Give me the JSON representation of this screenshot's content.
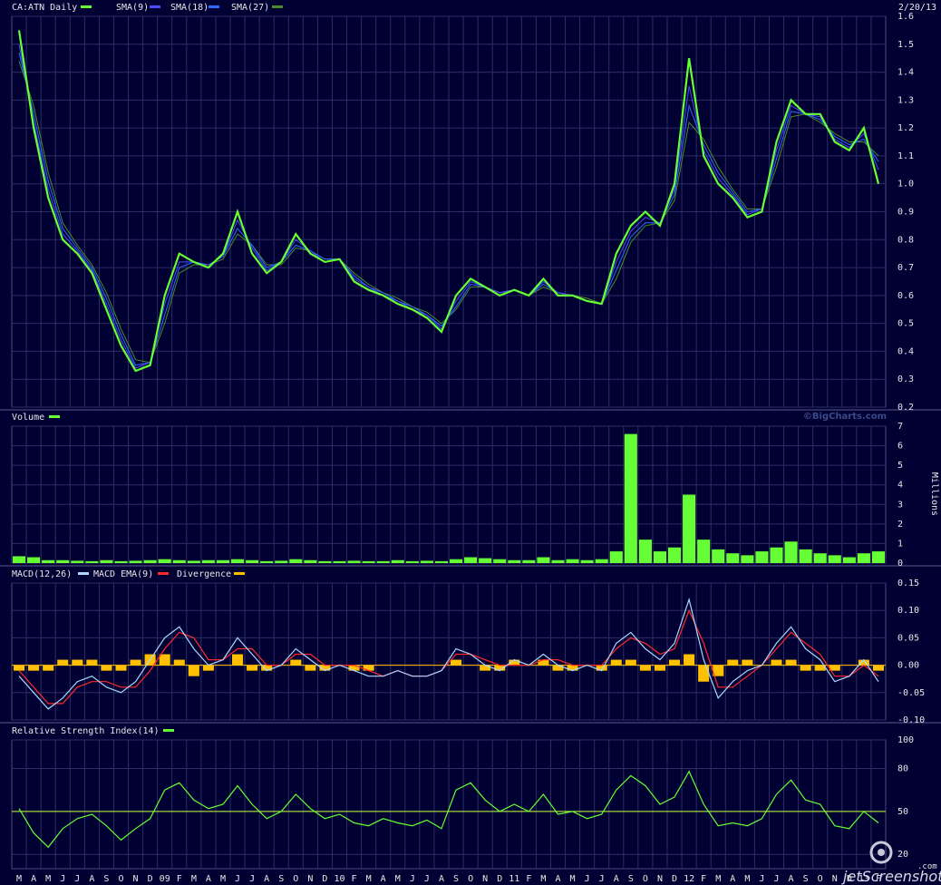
{
  "chart_data": [
    {
      "type": "line",
      "panel": "price",
      "title": "CA:ATN Daily",
      "date_label": "2/20/13",
      "ylim": [
        0.2,
        1.6
      ],
      "yticks": [
        "1.6",
        "1.5",
        "1.4",
        "1.3",
        "1.2",
        "1.1",
        "1.0",
        "0.9",
        "0.8",
        "0.7",
        "0.6",
        "0.5",
        "0.4",
        "0.3",
        "0.2"
      ],
      "legend": [
        {
          "name": "CA:ATN Daily",
          "color": "#66ff33"
        },
        {
          "name": "SMA(9)",
          "color": "#4a4aff"
        },
        {
          "name": "SMA(18)",
          "color": "#2b6bff"
        },
        {
          "name": "SMA(27)",
          "color": "#4d8a2a"
        }
      ],
      "x_months": [
        "M",
        "A",
        "M",
        "J",
        "J",
        "A",
        "S",
        "O",
        "N",
        "D",
        "09",
        "F",
        "M",
        "A",
        "M",
        "J",
        "J",
        "A",
        "S",
        "O",
        "N",
        "D",
        "10",
        "F",
        "M",
        "A",
        "M",
        "J",
        "J",
        "A",
        "S",
        "O",
        "N",
        "D",
        "11",
        "F",
        "M",
        "A",
        "M",
        "J",
        "J",
        "A",
        "S",
        "O",
        "N",
        "D",
        "12",
        "F",
        "M",
        "A",
        "M",
        "J",
        "J",
        "A",
        "S",
        "O",
        "N",
        "D",
        "13",
        "F"
      ],
      "series": [
        {
          "name": "CA:ATN Daily",
          "values": [
            1.55,
            1.2,
            0.95,
            0.8,
            0.75,
            0.68,
            0.55,
            0.42,
            0.33,
            0.35,
            0.6,
            0.75,
            0.72,
            0.7,
            0.75,
            0.9,
            0.75,
            0.68,
            0.72,
            0.82,
            0.75,
            0.72,
            0.73,
            0.65,
            0.62,
            0.6,
            0.57,
            0.55,
            0.52,
            0.47,
            0.6,
            0.66,
            0.63,
            0.6,
            0.62,
            0.6,
            0.66,
            0.6,
            0.6,
            0.58,
            0.57,
            0.75,
            0.85,
            0.9,
            0.85,
            1.0,
            1.45,
            1.1,
            1.0,
            0.95,
            0.88,
            0.9,
            1.15,
            1.3,
            1.25,
            1.25,
            1.15,
            1.12,
            1.2,
            1.0
          ]
        },
        {
          "name": "SMA(9)",
          "values": [
            1.5,
            1.22,
            0.98,
            0.82,
            0.76,
            0.69,
            0.57,
            0.44,
            0.34,
            0.36,
            0.57,
            0.72,
            0.72,
            0.71,
            0.74,
            0.87,
            0.77,
            0.69,
            0.72,
            0.8,
            0.76,
            0.72,
            0.73,
            0.66,
            0.63,
            0.6,
            0.58,
            0.55,
            0.53,
            0.48,
            0.58,
            0.65,
            0.63,
            0.61,
            0.62,
            0.6,
            0.65,
            0.61,
            0.6,
            0.58,
            0.57,
            0.72,
            0.83,
            0.88,
            0.86,
            0.98,
            1.35,
            1.12,
            1.02,
            0.96,
            0.89,
            0.91,
            1.12,
            1.28,
            1.25,
            1.24,
            1.16,
            1.13,
            1.18,
            1.05
          ]
        },
        {
          "name": "SMA(18)",
          "values": [
            1.47,
            1.25,
            1.01,
            0.84,
            0.77,
            0.7,
            0.59,
            0.46,
            0.35,
            0.36,
            0.53,
            0.7,
            0.72,
            0.71,
            0.74,
            0.84,
            0.78,
            0.7,
            0.72,
            0.78,
            0.76,
            0.73,
            0.73,
            0.67,
            0.63,
            0.61,
            0.58,
            0.56,
            0.53,
            0.49,
            0.56,
            0.64,
            0.63,
            0.61,
            0.62,
            0.6,
            0.64,
            0.61,
            0.6,
            0.58,
            0.57,
            0.69,
            0.81,
            0.86,
            0.86,
            0.96,
            1.28,
            1.14,
            1.04,
            0.97,
            0.9,
            0.91,
            1.09,
            1.26,
            1.25,
            1.23,
            1.17,
            1.14,
            1.16,
            1.08
          ]
        },
        {
          "name": "SMA(27)",
          "values": [
            1.44,
            1.28,
            1.04,
            0.86,
            0.78,
            0.71,
            0.61,
            0.48,
            0.37,
            0.36,
            0.5,
            0.68,
            0.71,
            0.71,
            0.73,
            0.82,
            0.78,
            0.71,
            0.71,
            0.77,
            0.76,
            0.73,
            0.73,
            0.68,
            0.64,
            0.61,
            0.59,
            0.56,
            0.54,
            0.5,
            0.55,
            0.63,
            0.63,
            0.61,
            0.62,
            0.6,
            0.63,
            0.61,
            0.6,
            0.59,
            0.57,
            0.66,
            0.79,
            0.85,
            0.86,
            0.94,
            1.22,
            1.16,
            1.06,
            0.98,
            0.91,
            0.91,
            1.06,
            1.24,
            1.25,
            1.22,
            1.18,
            1.15,
            1.15,
            1.1
          ]
        }
      ]
    },
    {
      "type": "bar",
      "panel": "volume",
      "title": "Volume",
      "watermark": "©BigCharts.com",
      "ylabel": "Millions",
      "ylim": [
        0,
        7
      ],
      "yticks": [
        "7",
        "6",
        "5",
        "4",
        "3",
        "2",
        "1",
        "0"
      ],
      "legend": [
        {
          "name": "Volume",
          "color": "#66ff33"
        }
      ],
      "values": [
        0.35,
        0.3,
        0.15,
        0.15,
        0.12,
        0.1,
        0.15,
        0.1,
        0.12,
        0.15,
        0.2,
        0.15,
        0.12,
        0.15,
        0.15,
        0.2,
        0.15,
        0.1,
        0.12,
        0.2,
        0.15,
        0.1,
        0.1,
        0.12,
        0.1,
        0.1,
        0.15,
        0.1,
        0.12,
        0.1,
        0.2,
        0.3,
        0.25,
        0.2,
        0.15,
        0.15,
        0.3,
        0.15,
        0.2,
        0.15,
        0.2,
        0.6,
        6.6,
        1.2,
        0.6,
        0.8,
        3.5,
        1.2,
        0.7,
        0.5,
        0.4,
        0.6,
        0.8,
        1.1,
        0.7,
        0.5,
        0.4,
        0.3,
        0.5,
        0.6
      ]
    },
    {
      "type": "line",
      "panel": "macd",
      "title": "MACD(12,26)",
      "ylim": [
        -0.1,
        0.15
      ],
      "yticks": [
        "0.15",
        "0.10",
        "0.05",
        "0.00",
        "-0.05",
        "-0.10"
      ],
      "legend": [
        {
          "name": "MACD(12,26)",
          "color": "#a8d8ff"
        },
        {
          "name": "MACD EMA(9)",
          "color": "#ff2a2a"
        },
        {
          "name": "Divergence",
          "color": "#ffc000"
        }
      ],
      "series": [
        {
          "name": "MACD(12,26)",
          "values": [
            -0.02,
            -0.05,
            -0.08,
            -0.06,
            -0.03,
            -0.02,
            -0.04,
            -0.05,
            -0.03,
            0.01,
            0.05,
            0.07,
            0.03,
            0.0,
            0.01,
            0.05,
            0.02,
            -0.01,
            0.0,
            0.03,
            0.01,
            -0.01,
            0.0,
            -0.01,
            -0.02,
            -0.02,
            -0.01,
            -0.02,
            -0.02,
            -0.01,
            0.03,
            0.02,
            0.0,
            -0.01,
            0.01,
            0.0,
            0.02,
            0.0,
            -0.01,
            0.0,
            -0.01,
            0.04,
            0.06,
            0.03,
            0.01,
            0.04,
            0.12,
            0.01,
            -0.06,
            -0.03,
            -0.01,
            0.0,
            0.04,
            0.07,
            0.03,
            0.01,
            -0.03,
            -0.02,
            0.01,
            -0.03
          ]
        },
        {
          "name": "MACD EMA(9)",
          "values": [
            -0.01,
            -0.04,
            -0.07,
            -0.07,
            -0.04,
            -0.03,
            -0.03,
            -0.04,
            -0.04,
            -0.01,
            0.03,
            0.06,
            0.05,
            0.01,
            0.01,
            0.03,
            0.03,
            0.0,
            0.0,
            0.02,
            0.02,
            0.0,
            0.0,
            0.0,
            -0.01,
            -0.02,
            -0.01,
            -0.02,
            -0.02,
            -0.01,
            0.02,
            0.02,
            0.01,
            0.0,
            0.0,
            0.0,
            0.01,
            0.01,
            0.0,
            0.0,
            0.0,
            0.03,
            0.05,
            0.04,
            0.02,
            0.03,
            0.1,
            0.04,
            -0.04,
            -0.04,
            -0.02,
            0.0,
            0.03,
            0.06,
            0.04,
            0.02,
            -0.02,
            -0.02,
            0.0,
            -0.02
          ]
        },
        {
          "name": "Divergence",
          "values": [
            -0.01,
            -0.01,
            -0.01,
            0.01,
            0.01,
            0.01,
            -0.01,
            -0.01,
            0.01,
            0.02,
            0.02,
            0.01,
            -0.02,
            -0.01,
            0.0,
            0.02,
            -0.01,
            -0.01,
            0.0,
            0.01,
            -0.01,
            -0.01,
            0.0,
            -0.01,
            -0.01,
            0.0,
            0.0,
            0.0,
            0.0,
            0.0,
            0.01,
            0.0,
            -0.01,
            -0.01,
            0.01,
            0.0,
            0.01,
            -0.01,
            -0.01,
            0.0,
            -0.01,
            0.01,
            0.01,
            -0.01,
            -0.01,
            0.01,
            0.02,
            -0.03,
            -0.02,
            0.01,
            0.01,
            0.0,
            0.01,
            0.01,
            -0.01,
            -0.01,
            -0.01,
            0.0,
            0.01,
            -0.01
          ]
        }
      ]
    },
    {
      "type": "line",
      "panel": "rsi",
      "title": "Relative Strength Index(14)",
      "ylim": [
        10,
        100
      ],
      "yticks": [
        "100",
        "80",
        "50",
        "20"
      ],
      "legend": [
        {
          "name": "Relative Strength Index(14)",
          "color": "#66ff33"
        }
      ],
      "reference_line": 50,
      "series": [
        {
          "name": "Relative Strength Index(14)",
          "values": [
            52,
            35,
            25,
            38,
            45,
            48,
            40,
            30,
            38,
            45,
            65,
            70,
            58,
            52,
            55,
            68,
            55,
            45,
            50,
            62,
            52,
            45,
            48,
            42,
            40,
            45,
            42,
            40,
            44,
            38,
            65,
            70,
            58,
            50,
            55,
            50,
            62,
            48,
            50,
            45,
            48,
            65,
            75,
            68,
            55,
            60,
            78,
            55,
            40,
            42,
            40,
            45,
            62,
            72,
            58,
            55,
            40,
            38,
            50,
            42
          ]
        }
      ]
    }
  ],
  "branding": {
    "watermark_text": "jetScreenshot",
    "watermark_suffix": ".com"
  }
}
